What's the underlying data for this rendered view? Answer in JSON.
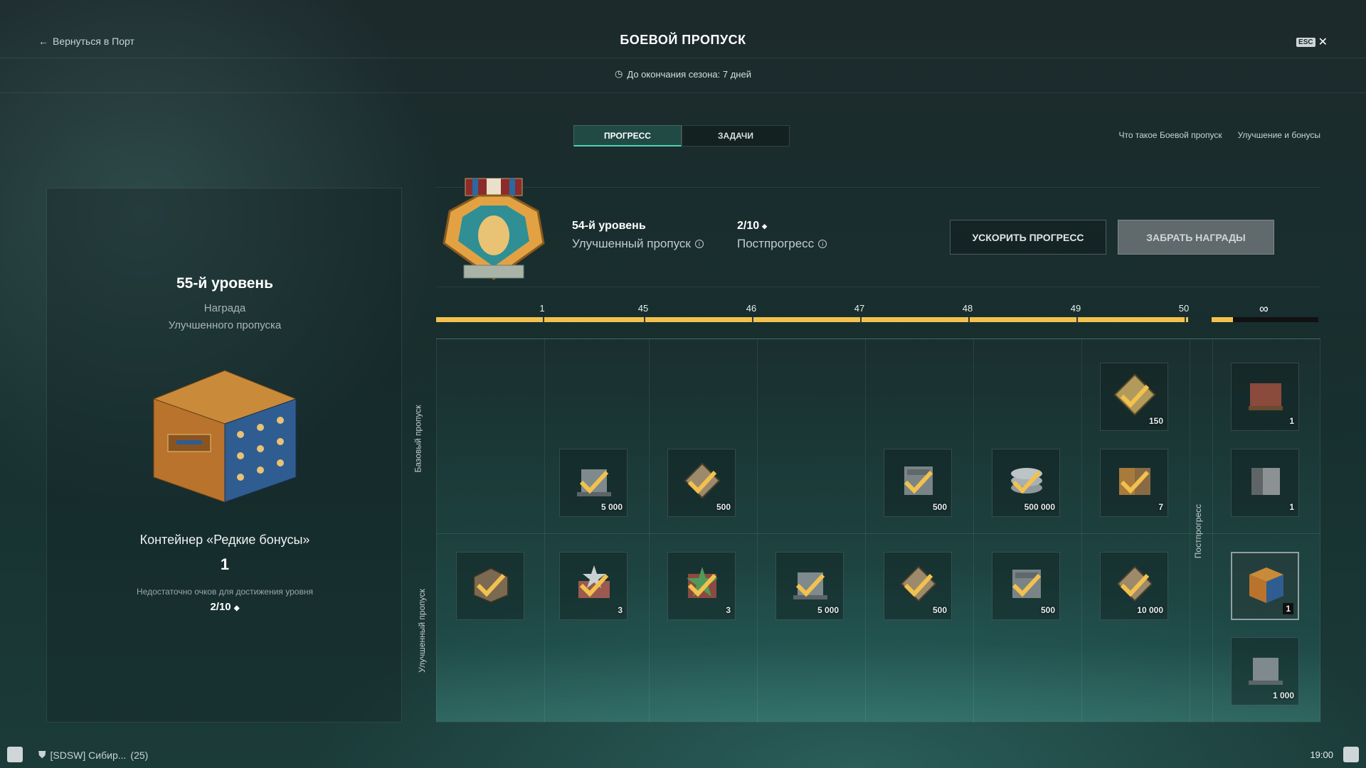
{
  "header": {
    "back_label": "Вернуться в Порт",
    "title": "БОЕВОЙ ПРОПУСК",
    "esc_label": "ESC",
    "season_timer": "До окончания сезона: 7 дней"
  },
  "tabs": [
    {
      "label": "ПРОГРЕСС",
      "active": true
    },
    {
      "label": "ЗАДАЧИ",
      "active": false
    }
  ],
  "links": {
    "what_is": "Что такое Боевой пропуск",
    "upgrade": "Улучшение и бонусы"
  },
  "selected_reward": {
    "level": "55-й уровень",
    "caption1": "Награда",
    "caption2": "Улучшенного пропуска",
    "item_name": "Контейнер «Редкие бонусы»",
    "count": "1",
    "note": "Недостаточно очков для достижения уровня",
    "points": "2/10"
  },
  "status": {
    "level": "54-й уровень",
    "pass_type": "Улучшенный пропуск",
    "points": "2/10",
    "post_label": "Постпрогресс"
  },
  "buttons": {
    "speed_up": "УСКОРИТЬ ПРОГРЕСС",
    "claim": "ЗАБРАТЬ НАГРАДЫ"
  },
  "track": {
    "levels": [
      "1",
      "45",
      "46",
      "47",
      "48",
      "49",
      "50"
    ],
    "post_symbol": "∞",
    "post_progress": 0.2
  },
  "rows": {
    "base": "Базовый пропуск",
    "premium": "Улучшенный пропуск",
    "post": "Постпрогресс"
  },
  "base_rewards": [
    {
      "icon": "commanders-xp-icon",
      "count": "5 000"
    },
    {
      "icon": "signal-flag-icon",
      "count": "500"
    },
    {
      "icon": "steel-stack-icon",
      "count": "500"
    },
    {
      "icon": "credits-icon",
      "count": "500 000"
    },
    {
      "icon": "diamond-token-icon",
      "count": "150"
    },
    {
      "icon": "container-icon",
      "count": "7"
    }
  ],
  "premium_rewards": [
    {
      "icon": "camouflage-icon",
      "count": ""
    },
    {
      "icon": "star-flag-icon",
      "count": "3"
    },
    {
      "icon": "green-star-icon",
      "count": "3"
    },
    {
      "icon": "commanders-xp-icon",
      "count": "5 000"
    },
    {
      "icon": "signal-flag-icon",
      "count": "500"
    },
    {
      "icon": "steel-stack-icon",
      "count": "500"
    },
    {
      "icon": "signal-flag-icon",
      "count": "10 000"
    }
  ],
  "post_rewards": [
    {
      "icon": "red-crate-icon",
      "count": "1"
    },
    {
      "icon": "grey-crate-icon",
      "count": "1"
    },
    {
      "icon": "blue-container-icon",
      "count": "1"
    },
    {
      "icon": "commanders-xp-icon",
      "count": "1 000"
    }
  ],
  "footer": {
    "clan": "[SDSW] Сибир...",
    "clan_count": "(25)",
    "time": "19:00"
  },
  "colors": {
    "accent": "#f2c14e",
    "tab_active": "#4fd1b4"
  }
}
